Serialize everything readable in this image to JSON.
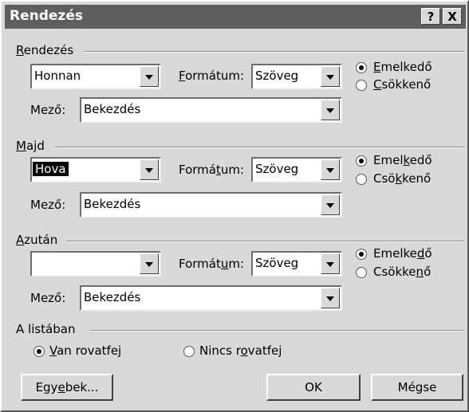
{
  "dialog": {
    "title": "Rendezés",
    "help_btn": "?",
    "close_btn": "X"
  },
  "groups": [
    {
      "label_pre": "",
      "label_ul": "R",
      "label_post": "endezés",
      "source": {
        "value": "Honnan",
        "highlighted": false
      },
      "format_label": {
        "pre": "",
        "ul": "F",
        "post": "ormátum:"
      },
      "format_value": "Szöveg",
      "field_label": "Mező:",
      "field_value": "Bekezdés",
      "asc": {
        "pre": "",
        "ul": "E",
        "post": "melkedő",
        "selected": true
      },
      "desc": {
        "pre": "",
        "ul": "C",
        "post": "sökkenő",
        "selected": false
      }
    },
    {
      "label_pre": "",
      "label_ul": "M",
      "label_post": "ajd",
      "source": {
        "value": "Hova",
        "highlighted": true
      },
      "format_label": {
        "pre": "Formá",
        "ul": "t",
        "post": "um:"
      },
      "format_value": "Szöveg",
      "field_label": "Mező:",
      "field_value": "Bekezdés",
      "asc": {
        "pre": "Emel",
        "ul": "k",
        "post": "edő",
        "selected": true
      },
      "desc": {
        "pre": "Csö",
        "ul": "k",
        "post": "kenő",
        "selected": false
      }
    },
    {
      "label_pre": "",
      "label_ul": "A",
      "label_post": "zután",
      "source": {
        "value": "",
        "highlighted": false
      },
      "format_label": {
        "pre": "Formát",
        "ul": "u",
        "post": "m:"
      },
      "format_value": "Szöveg",
      "field_label": "Mező:",
      "field_value": "Bekezdés",
      "asc": {
        "pre": "Emelke",
        "ul": "d",
        "post": "ő",
        "selected": true
      },
      "desc": {
        "pre": "Csökke",
        "ul": "n",
        "post": "ő",
        "selected": false
      }
    }
  ],
  "list_group": {
    "label": "A listában",
    "has_header": {
      "pre": "",
      "ul": "V",
      "post": "an rovatfej",
      "selected": true
    },
    "no_header": {
      "pre": "Nincs r",
      "ul": "o",
      "post": "vatfej",
      "selected": false
    }
  },
  "buttons": {
    "more": {
      "pre": "Egy",
      "ul": "e",
      "post": "bek..."
    },
    "ok": "OK",
    "cancel": "Mégse"
  }
}
